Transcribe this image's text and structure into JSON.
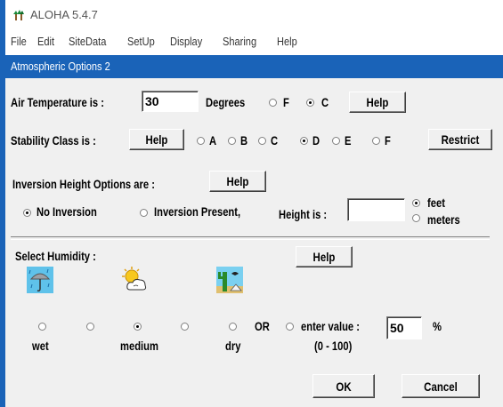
{
  "app": {
    "title": "ALOHA 5.4.7"
  },
  "menu": [
    "File",
    "Edit",
    "SiteData",
    "SetUp",
    "Display",
    "Sharing",
    "Help"
  ],
  "dialog": {
    "title": "Atmospheric Options 2"
  },
  "air_temp": {
    "label": "Air Temperature is :",
    "value": "30",
    "degrees_label": "Degrees",
    "unit_f": "F",
    "unit_c": "C",
    "selected_unit": "C",
    "help": "Help"
  },
  "stability": {
    "label": "Stability Class is :",
    "help": "Help",
    "classes": [
      "A",
      "B",
      "C",
      "D",
      "E",
      "F"
    ],
    "selected": "D",
    "restrict": "Restrict"
  },
  "inversion": {
    "label": "Inversion Height Options are :",
    "help": "Help",
    "no_inversion": "No Inversion",
    "inversion_present": "Inversion Present,",
    "height_label": "Height is :",
    "height_value": "",
    "unit_feet": "feet",
    "unit_meters": "meters",
    "selected_option": "No Inversion",
    "selected_unit": "feet"
  },
  "humidity": {
    "label": "Select Humidity :",
    "help": "Help",
    "icons": [
      "umbrella-icon",
      "sun-cloud-icon",
      "cactus-icon"
    ],
    "wet": "wet",
    "medium": "medium",
    "dry": "dry",
    "or": "OR",
    "enter_value": "enter value :",
    "value": "50",
    "percent": "%",
    "range": "(0 - 100)",
    "selected": "medium"
  },
  "buttons": {
    "ok": "OK",
    "cancel": "Cancel"
  },
  "colors": {
    "title_bar": "#1a63b8",
    "dialog_bg": "#f0f0f0"
  }
}
